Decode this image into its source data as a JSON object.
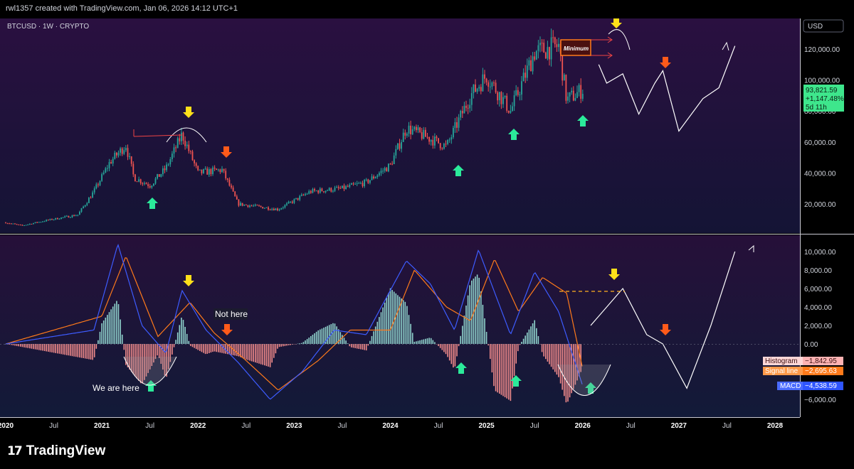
{
  "header": {
    "credit": "rwl1357 created with TradingView.com, Jan 06, 2026 14:12 UTC+1"
  },
  "symbol": {
    "label": "BTCUSD · 1W · CRYPTO"
  },
  "currency": "USD",
  "footer": {
    "brand_mark": "17",
    "brand_name": "TradingView"
  },
  "colors": {
    "bg_top": "#2a1040",
    "bg_bottom": "#131232",
    "candle_up": "#26a69a",
    "candle_down": "#ef5350",
    "macd": "#3d5cff",
    "signal": "#ff7a1a",
    "hist_pos": "#8fd3cc",
    "hist_neg": "#f28b8b",
    "arrow_yellow": "#ffe01a",
    "arrow_orange": "#ff5a1a",
    "arrow_green": "#2bea9a",
    "price_tag": "#3ee68c",
    "hist_tag": "#ffb3b3",
    "signal_tag": "#ff7a1a",
    "macd_tag": "#2f55ff"
  },
  "annotations": {
    "minimum": "Minimum",
    "not_here": "Not here",
    "we_are_here": "We are here"
  },
  "price_tag": {
    "price": "93,821.59",
    "change": "+1,147.48%",
    "countdown": "5d 11h"
  },
  "legend": [
    {
      "label": "Histogram",
      "value": "−1,842.95"
    },
    {
      "label": "Signal line",
      "value": "−2,695.63"
    },
    {
      "label": "MACD",
      "value": "−4,538.59"
    }
  ],
  "chart_data": [
    {
      "type": "candlestick",
      "title": "BTCUSD · 1W · CRYPTO",
      "ylim": [
        0,
        135000
      ],
      "y_ticks": [
        "20,000.00",
        "40,000.00",
        "60,000.00",
        "80,000.00",
        "100,000.00",
        "120,000.00"
      ],
      "x_ticks": [
        "2020",
        "Jul",
        "2021",
        "Jul",
        "2022",
        "Jul",
        "2023",
        "Jul",
        "2024",
        "Jul",
        "2025",
        "Jul",
        "2026",
        "Jul",
        "2027",
        "Jul",
        "2028"
      ],
      "series": [
        {
          "name": "BTCUSD weekly close (approx.)",
          "points": [
            [
              "2020-01",
              8000
            ],
            [
              "2020-03",
              6000
            ],
            [
              "2020-06",
              9300
            ],
            [
              "2020-10",
              13000
            ],
            [
              "2020-12",
              28000
            ],
            [
              "2021-02",
              47000
            ],
            [
              "2021-04",
              58000
            ],
            [
              "2021-05",
              37000
            ],
            [
              "2021-07",
              32000
            ],
            [
              "2021-09",
              43000
            ],
            [
              "2021-11",
              65000
            ],
            [
              "2022-01",
              40000
            ],
            [
              "2022-04",
              42000
            ],
            [
              "2022-06",
              20000
            ],
            [
              "2022-11",
              16500
            ],
            [
              "2023-03",
              28000
            ],
            [
              "2023-07",
              30000
            ],
            [
              "2023-10",
              34000
            ],
            [
              "2024-01",
              45000
            ],
            [
              "2024-03",
              69000
            ],
            [
              "2024-06",
              62000
            ],
            [
              "2024-08",
              57000
            ],
            [
              "2024-11",
              90000
            ],
            [
              "2025-01",
              103000
            ],
            [
              "2025-04",
              80000
            ],
            [
              "2025-07",
              118000
            ],
            [
              "2025-10",
              122000
            ],
            [
              "2025-11",
              87000
            ],
            [
              "2026-01",
              93821.59
            ]
          ]
        },
        {
          "name": "Projected path (drawn)",
          "points": [
            [
              "2026-03",
              110000
            ],
            [
              "2026-04",
              98000
            ],
            [
              "2026-06",
              104000
            ],
            [
              "2026-08",
              78000
            ],
            [
              "2026-10",
              98000
            ],
            [
              "2026-11",
              106000
            ],
            [
              "2027-01",
              67000
            ],
            [
              "2027-04",
              88000
            ],
            [
              "2027-06",
              95000
            ],
            [
              "2027-08",
              122000
            ]
          ]
        }
      ]
    },
    {
      "type": "line",
      "title": "MACD",
      "ylim": [
        -7000,
        11000
      ],
      "y_ticks": [
        "10,000.00",
        "8,000.00",
        "6,000.00",
        "4,000.00",
        "2,000.00",
        "0.00",
        "−2,000.00",
        "−4,000.00",
        "−6,000.00"
      ],
      "series": [
        {
          "name": "MACD",
          "points": [
            [
              "2020-01",
              0
            ],
            [
              "2020-12",
              1500
            ],
            [
              "2021-03",
              10800
            ],
            [
              "2021-06",
              2000
            ],
            [
              "2021-09",
              -1000
            ],
            [
              "2021-11",
              5800
            ],
            [
              "2022-02",
              1500
            ],
            [
              "2022-06",
              -2000
            ],
            [
              "2022-10",
              -6000
            ],
            [
              "2023-02",
              -3000
            ],
            [
              "2023-06",
              1500
            ],
            [
              "2023-10",
              1000
            ],
            [
              "2024-03",
              9000
            ],
            [
              "2024-06",
              6500
            ],
            [
              "2024-09",
              1500
            ],
            [
              "2024-12",
              10200
            ],
            [
              "2025-04",
              1000
            ],
            [
              "2025-07",
              7800
            ],
            [
              "2025-10",
              3500
            ],
            [
              "2026-01",
              -4538.59
            ]
          ]
        },
        {
          "name": "Signal line",
          "points": [
            [
              "2020-01",
              0
            ],
            [
              "2021-01",
              3000
            ],
            [
              "2021-04",
              9500
            ],
            [
              "2021-08",
              800
            ],
            [
              "2021-12",
              4500
            ],
            [
              "2022-03",
              1200
            ],
            [
              "2022-07",
              -1800
            ],
            [
              "2022-11",
              -5000
            ],
            [
              "2023-04",
              -1800
            ],
            [
              "2023-08",
              1500
            ],
            [
              "2024-01",
              1500
            ],
            [
              "2024-04",
              8000
            ],
            [
              "2024-08",
              4000
            ],
            [
              "2024-11",
              2500
            ],
            [
              "2025-02",
              9200
            ],
            [
              "2025-05",
              3500
            ],
            [
              "2025-08",
              7200
            ],
            [
              "2025-11",
              5500
            ],
            [
              "2026-01",
              -2695.63
            ]
          ]
        },
        {
          "name": "Histogram",
          "values_note": "alternating positive/negative bars",
          "last": -1842.95
        },
        {
          "name": "Projected path (drawn)",
          "points": [
            [
              "2026-02",
              2000
            ],
            [
              "2026-06",
              6000
            ],
            [
              "2026-09",
              1000
            ],
            [
              "2026-11",
              0
            ],
            [
              "2027-02",
              -4800
            ],
            [
              "2027-05",
              2000
            ],
            [
              "2027-08",
              10000
            ]
          ]
        }
      ]
    }
  ]
}
